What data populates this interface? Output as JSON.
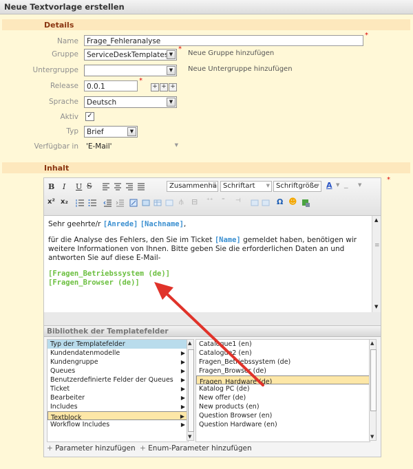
{
  "title": "Neue Textvorlage erstellen",
  "sections": {
    "details": "Details",
    "inhalt": "Inhalt"
  },
  "form": {
    "name": {
      "label": "Name",
      "value": "Frage_Fehleranalyse"
    },
    "gruppe": {
      "label": "Gruppe",
      "value": "ServiceDeskTemplates",
      "link": "Neue Gruppe hinzufügen"
    },
    "untergruppe": {
      "label": "Untergruppe",
      "value": "",
      "link": "Neue Untergruppe hinzufügen"
    },
    "release": {
      "label": "Release",
      "value": "0.0.1"
    },
    "sprache": {
      "label": "Sprache",
      "value": "Deutsch"
    },
    "aktiv": {
      "label": "Aktiv",
      "checked": true
    },
    "typ": {
      "label": "Typ",
      "value": "Brief"
    },
    "verfuegbar": {
      "label": "Verfügbar in",
      "value": "'E-Mail'"
    }
  },
  "toolbar": {
    "bold": "B",
    "italic": "I",
    "underline": "U",
    "strike": "S",
    "format_select": "Zusammenhäng",
    "font_select": "Schriftart",
    "size_select": "Schriftgröße",
    "superscript": "x²",
    "subscript": "x₂",
    "special_char": "Ω"
  },
  "editor": {
    "greeting_prefix": "Sehr geehrte/r",
    "anrede": "[Anrede]",
    "nachname": "[Nachname]",
    "greeting_suffix": ",",
    "body_1": "für die Analyse des Fehlers, den Sie im Ticket",
    "ticket_name": "[Name]",
    "body_2": "gemeldet haben, benötigen wir weitere Informationen von Ihnen. Bitte geben Sie die erforderlichen Daten an und antworten Sie auf diese E-Mail-",
    "textblock_1": "[Fragen_Betriebssystem (de)]",
    "textblock_2": "[Fragen_Browser (de)]"
  },
  "library": {
    "title": "Bibliothek der Templatefelder",
    "left_header": "Typ der Templatefelder",
    "left_items": [
      "Kundendatenmodelle",
      "Kundengruppe",
      "Queues",
      "Benutzerdefinierte Felder der Queues",
      "Ticket",
      "Bearbeiter",
      "Includes",
      "Textblock",
      "Workflow Includes"
    ],
    "left_selected": "Textblock",
    "right_items": [
      "Catalogue1 (en)",
      "Catalogue2 (en)",
      "Fragen_Betriebssystem (de)",
      "Fragen_Browser (de)",
      "Fragen_Hardware (de)",
      "Katalog PC (de)",
      "New offer (de)",
      "New products (en)",
      "Question Browser (en)",
      "Question Hardware (en)"
    ],
    "right_selected": "Fragen_Hardware (de)",
    "add_parameter": "Parameter hinzufügen",
    "add_enum_parameter": "Enum-Parameter hinzufügen"
  },
  "colors": {
    "accent_section": "#8a3510",
    "placeholder_blue": "#3a8fd0",
    "textblock_green": "#6bbf3f",
    "arrow_red": "#e0332a",
    "highlight": "#fde7a7"
  }
}
